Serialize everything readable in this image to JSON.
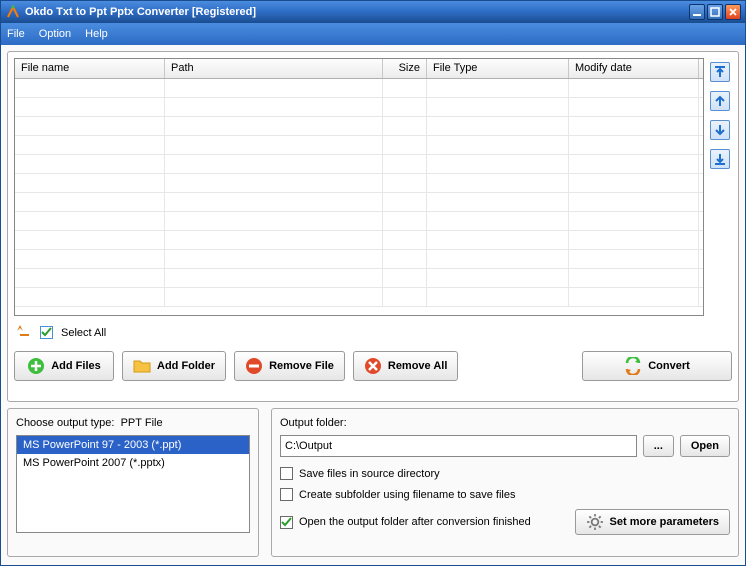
{
  "window": {
    "title": "Okdo Txt to Ppt Pptx Converter [Registered]"
  },
  "menu": {
    "file": "File",
    "option": "Option",
    "help": "Help"
  },
  "columns": {
    "name": "File name",
    "path": "Path",
    "size": "Size",
    "type": "File Type",
    "modify": "Modify date"
  },
  "select_all": {
    "label": "Select All",
    "checked": true
  },
  "buttons": {
    "add_files": "Add Files",
    "add_folder": "Add Folder",
    "remove_file": "Remove File",
    "remove_all": "Remove All",
    "convert": "Convert"
  },
  "output_type": {
    "label_prefix": "Choose output type:",
    "label_value": "PPT File",
    "options": [
      {
        "text": "MS PowerPoint 97 - 2003 (*.ppt)",
        "selected": true
      },
      {
        "text": "MS PowerPoint 2007 (*.pptx)",
        "selected": false
      }
    ]
  },
  "output_folder": {
    "label": "Output folder:",
    "value": "C:\\Output",
    "browse": "...",
    "open": "Open"
  },
  "checks": {
    "save_source": {
      "label": "Save files in source directory",
      "checked": false
    },
    "subfolder": {
      "label": "Create subfolder using filename to save files",
      "checked": false
    },
    "open_after": {
      "label": "Open the output folder after conversion finished",
      "checked": true
    }
  },
  "more_params": "Set more parameters",
  "icons": {
    "app": "app-icon",
    "min": "minimize-icon",
    "max": "maximize-icon",
    "close": "close-icon",
    "top": "move-top-icon",
    "up": "move-up-icon",
    "down": "move-down-icon",
    "bottom": "move-bottom-icon",
    "folder_up": "folder-up-icon",
    "plus": "plus-icon",
    "folder": "folder-icon",
    "minus": "minus-icon",
    "x": "x-icon",
    "convert": "convert-icon",
    "gear": "gear-icon"
  }
}
